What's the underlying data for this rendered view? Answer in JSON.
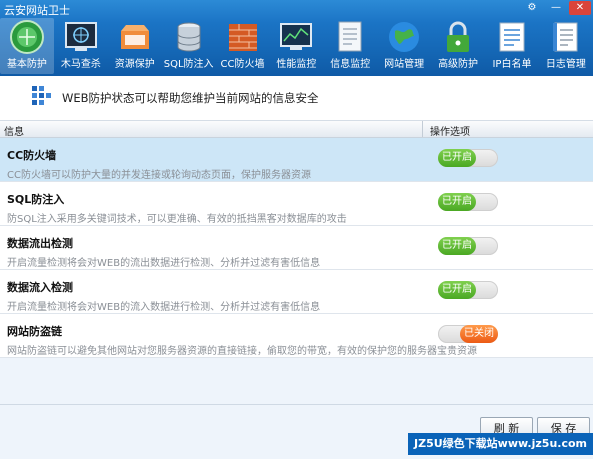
{
  "window": {
    "title": "云安网站卫士",
    "controls": [
      "⚙",
      "—",
      "✕"
    ]
  },
  "toolbar": {
    "items": [
      {
        "label": "基本防护",
        "icon": "shield-globe-icon",
        "active": true
      },
      {
        "label": "木马查杀",
        "icon": "virus-scan-icon",
        "active": false
      },
      {
        "label": "资源保护",
        "icon": "folder-box-icon",
        "active": false
      },
      {
        "label": "SQL防注入",
        "icon": "database-icon",
        "active": false
      },
      {
        "label": "CC防火墙",
        "icon": "firewall-brick-icon",
        "active": false
      },
      {
        "label": "性能监控",
        "icon": "monitor-chart-icon",
        "active": false
      },
      {
        "label": "信息监控",
        "icon": "document-icon",
        "active": false
      },
      {
        "label": "网站管理",
        "icon": "earth-globe-icon",
        "active": false
      },
      {
        "label": "高级防护",
        "icon": "padlock-icon",
        "active": false
      },
      {
        "label": "IP白名单",
        "icon": "ip-whitelist-icon",
        "active": false
      },
      {
        "label": "日志管理",
        "icon": "log-notebook-icon",
        "active": false
      }
    ]
  },
  "info_header": {
    "text": "WEB防护状态可以帮助您维护当前网站的信息安全"
  },
  "table": {
    "col_info": "信息",
    "col_options": "操作选项",
    "rows": [
      {
        "name": "CC防火墙",
        "desc": "CC防火墙可以防护大量的并发连接或轮询动态页面，保护服务器资源",
        "status": "已开启",
        "on": true,
        "selected": true
      },
      {
        "name": "SQL防注入",
        "desc": "防SQL注入采用多关键词技术，可以更准确、有效的抵挡黑客对数据库的攻击",
        "status": "已开启",
        "on": true,
        "selected": false
      },
      {
        "name": "数据流出检测",
        "desc": "开启流量检测将会对WEB的流出数据进行检测、分析并过滤有害低信息",
        "status": "已开启",
        "on": true,
        "selected": false
      },
      {
        "name": "数据流入检测",
        "desc": "开启流量检测将会对WEB的流入数据进行检测、分析并过滤有害低信息",
        "status": "已开启",
        "on": true,
        "selected": false
      },
      {
        "name": "网站防盗链",
        "desc": "网站防盗链可以避免其他网站对您服务器资源的直接链接，偷取您的带宽，有效的保护您的服务器宝贵资源",
        "status": "已关闭",
        "on": false,
        "selected": false
      }
    ]
  },
  "buttons": {
    "refresh": "刷 新",
    "save": "保 存"
  },
  "watermark": "JZ5U绿色下载站www.jz5u.com"
}
